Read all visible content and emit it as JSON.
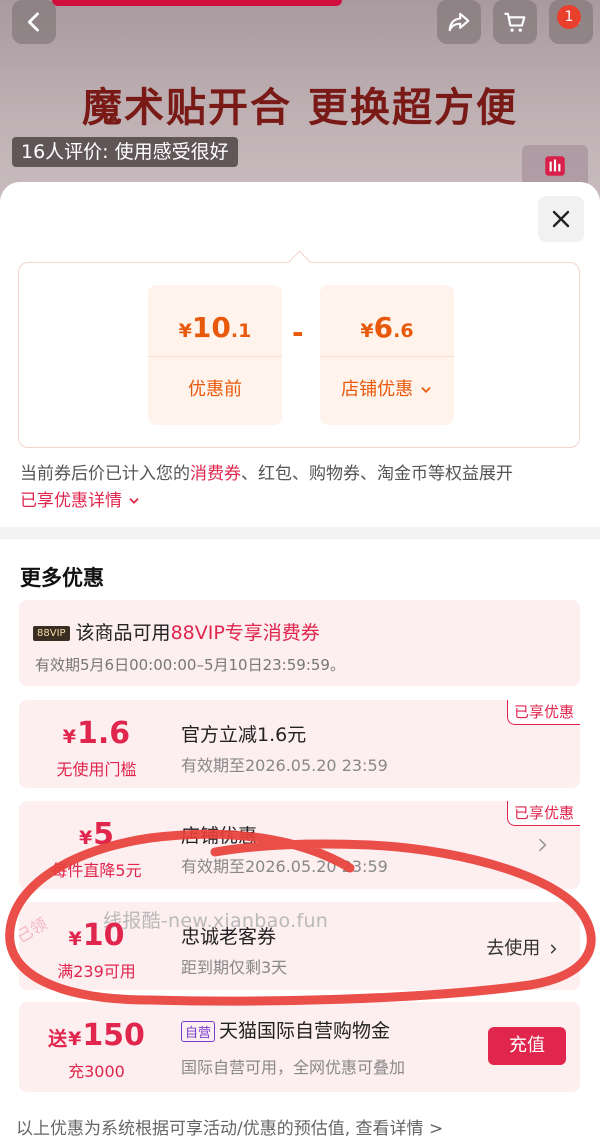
{
  "hero": {
    "title": "魔术贴开合 更换超方便",
    "review_pill": "16人评价: 使用感受很好",
    "cart_badge": "1"
  },
  "calc": {
    "before": {
      "currency": "¥",
      "int": "10",
      "dec": ".1",
      "label": "优惠前"
    },
    "minus": "-",
    "shop": {
      "currency": "¥",
      "int": "6",
      "dec": ".6",
      "label": "店铺优惠"
    }
  },
  "note": {
    "prefix": "当前券后价已计入您的",
    "highlight": "消费券",
    "suffix": "、红包、购物券、淘金币等权益展开",
    "link": "已享优惠详情"
  },
  "more": {
    "title": "更多优惠",
    "vip": {
      "tag": "88VIP",
      "prefix": "该商品可用",
      "highlight": "88VIP专享消费券",
      "validity": "有效期5月6日00:00:00–5月10日23:59:59。"
    },
    "coupons": [
      {
        "currency": "¥",
        "amount": "1.6",
        "condition": "无使用门槛",
        "title": "官方立减1.6元",
        "subtitle": "有效期至2026.05.20 23:59",
        "badge": "已享优惠"
      },
      {
        "currency": "¥",
        "amount": "5",
        "condition": "每件直降5元",
        "title": "店铺优惠",
        "subtitle": "有效期至2026.05.20 23:59",
        "badge": "已享优惠"
      },
      {
        "currency": "¥",
        "amount": "10",
        "condition": "满239可用",
        "title": "忠诚老客券",
        "subtitle": "距到期仅剩3天",
        "claimed": "已领",
        "action": "去使用",
        "watermark": "线报酷-new.xianbao.fun"
      }
    ],
    "gold": {
      "prefix": "送",
      "currency": "¥",
      "amount": "150",
      "condition": "充3000",
      "tag": "自营",
      "title": "天猫国际自营购物金",
      "subtitle": "国际自营可用，全网优惠可叠加",
      "button": "充值"
    }
  },
  "footer": {
    "text": "以上优惠为系统根据可享活动/优惠的预估值, 查看详情 >"
  },
  "colors": {
    "accent": "#e0264d",
    "orange": "#e8590c",
    "card_bg": "#fdeef0",
    "scribble": "#e8403a"
  }
}
